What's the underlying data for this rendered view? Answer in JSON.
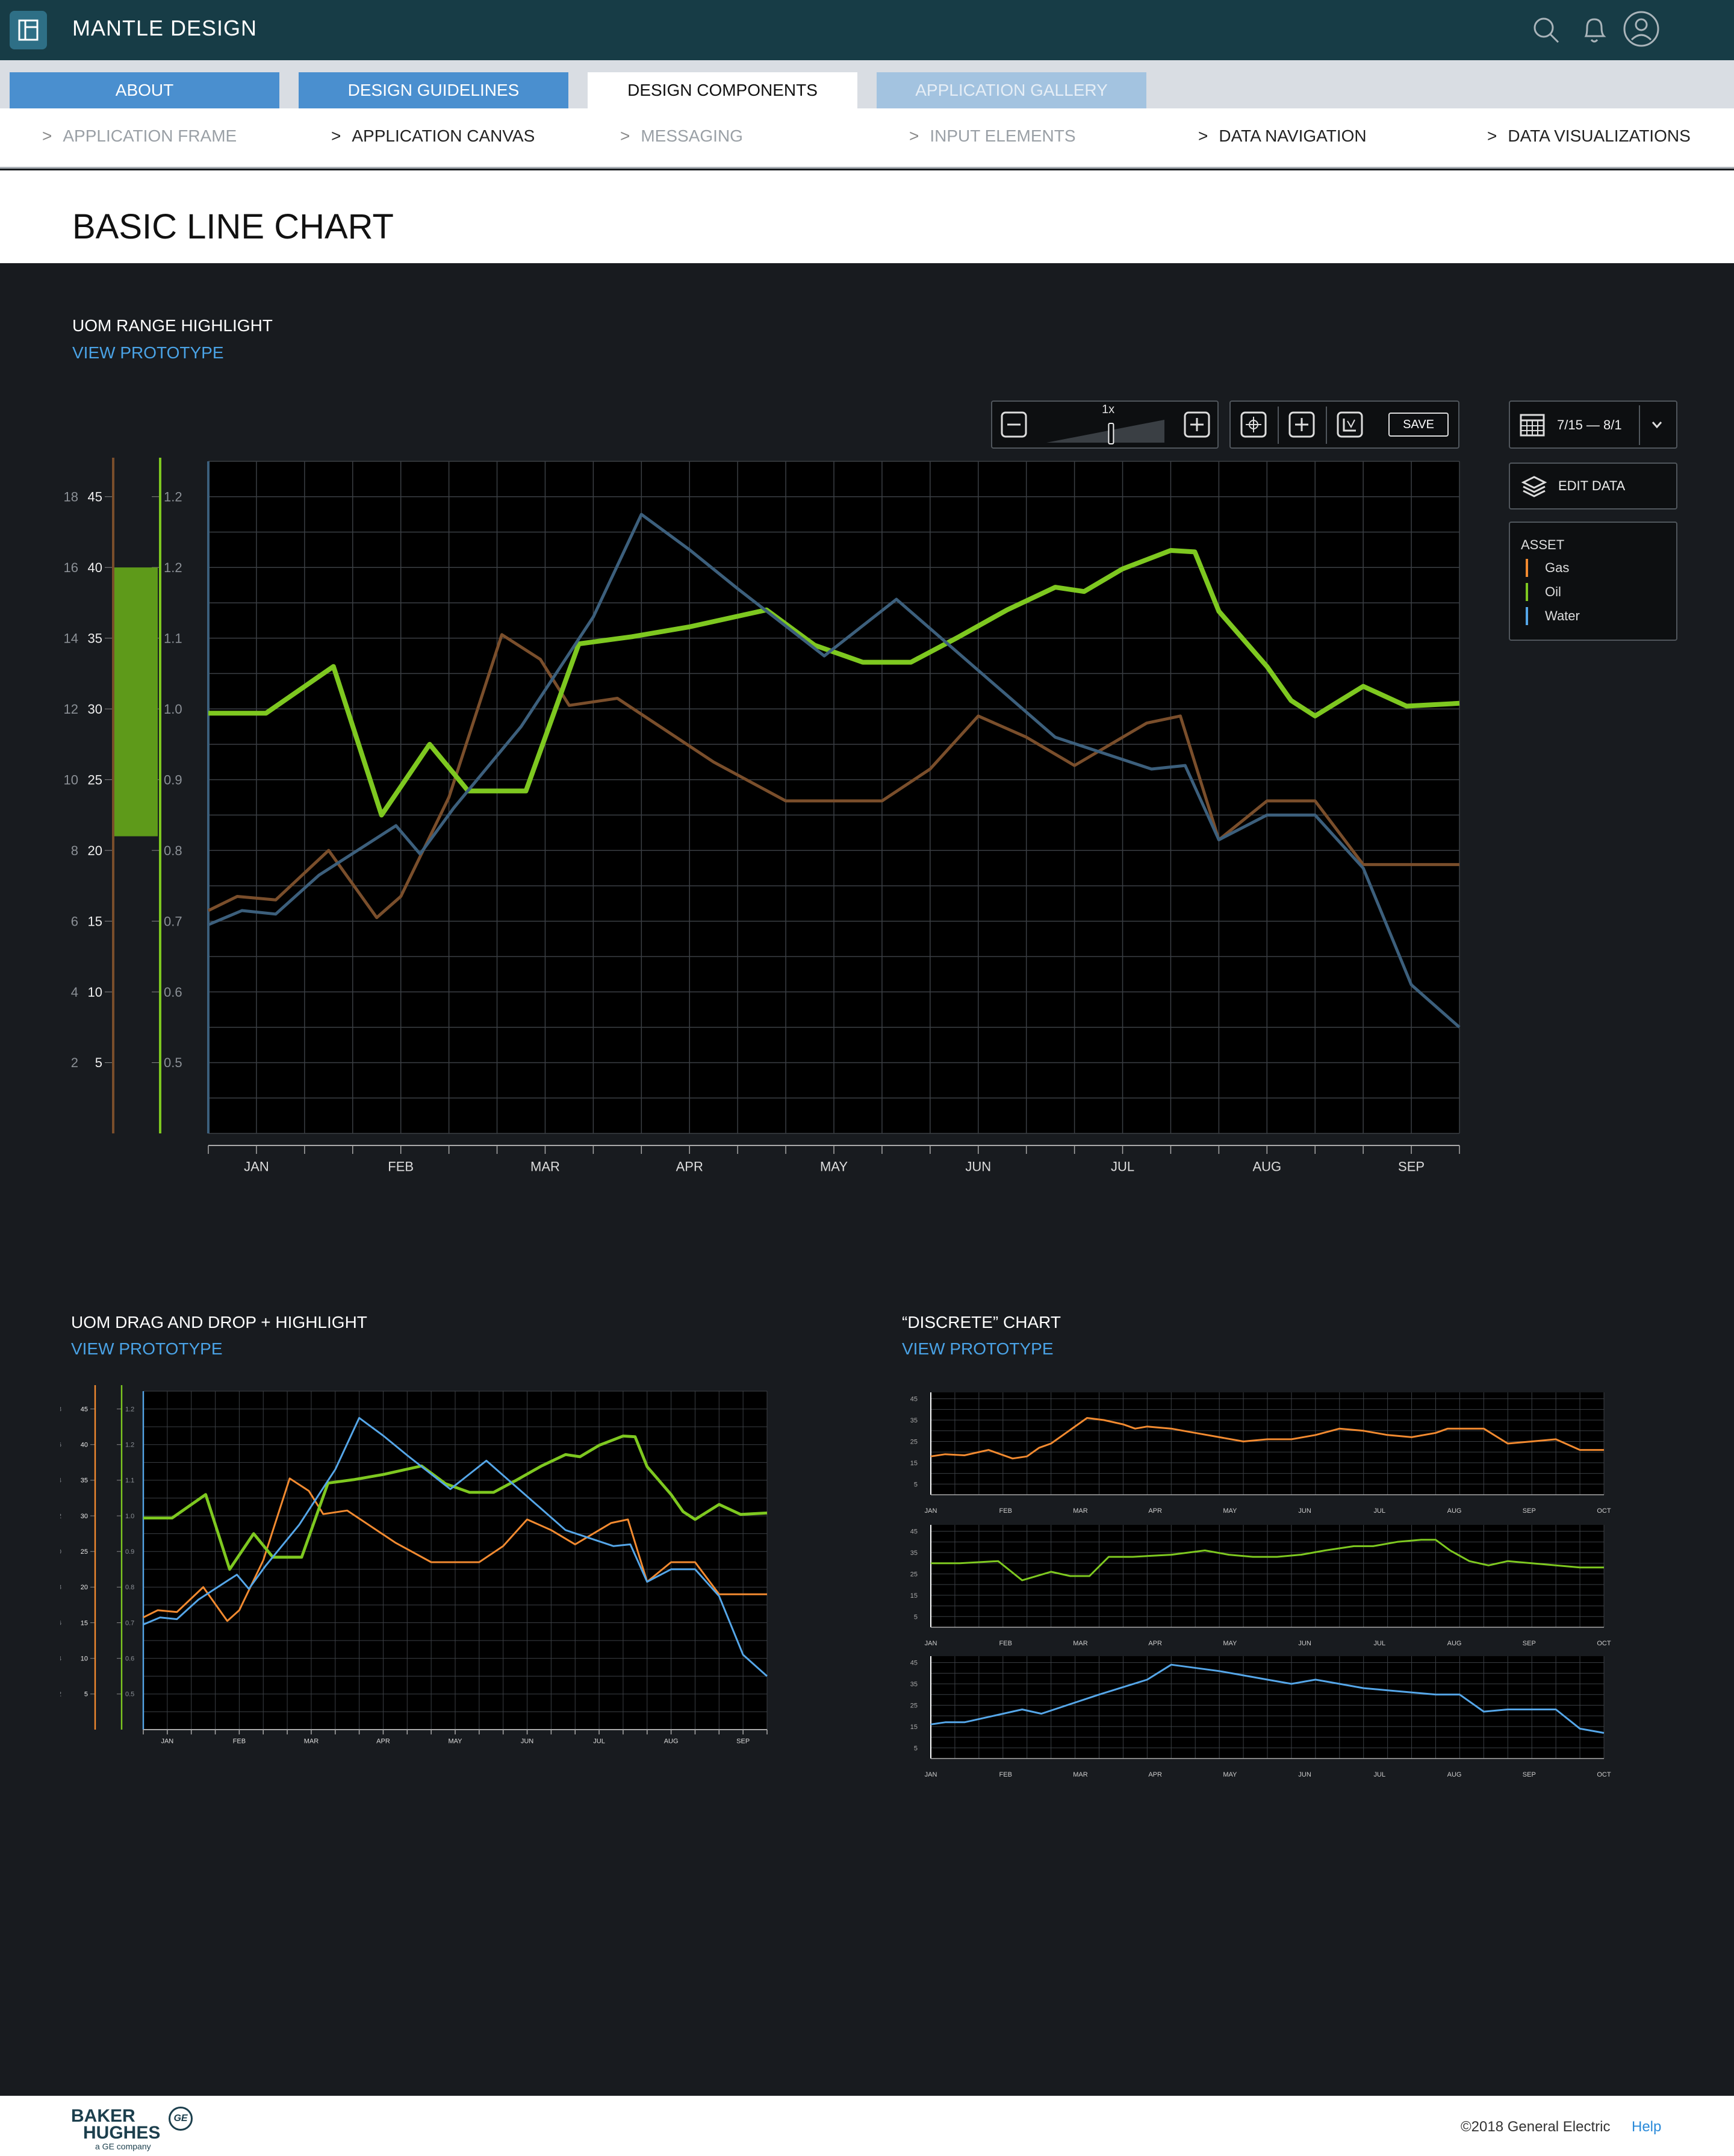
{
  "app": {
    "title": "MANTLE DESIGN"
  },
  "main_tabs": [
    {
      "label": "ABOUT",
      "state": "default"
    },
    {
      "label": "DESIGN GUIDELINES",
      "state": "default"
    },
    {
      "label": "DESIGN COMPONENTS",
      "state": "active"
    },
    {
      "label": "APPLICATION GALLERY",
      "state": "disabled"
    }
  ],
  "sub_nav": [
    {
      "label": "APPLICATION FRAME",
      "active": false
    },
    {
      "label": "APPLICATION CANVAS",
      "active": true
    },
    {
      "label": "MESSAGING",
      "active": false
    },
    {
      "label": "INPUT ELEMENTS",
      "active": false
    },
    {
      "label": "DATA NAVIGATION",
      "active": true
    },
    {
      "label": "DATA VISUALIZATIONS",
      "active": true
    }
  ],
  "page": {
    "title": "BASIC LINE CHART"
  },
  "sections": {
    "uom_range": {
      "title": "UOM RANGE HIGHLIGHT",
      "link": "VIEW PROTOTYPE"
    },
    "uom_drag": {
      "title": "UOM DRAG AND DROP + HIGHLIGHT",
      "link": "VIEW PROTOTYPE"
    },
    "discrete": {
      "title": "“DISCRETE” CHART",
      "link": "VIEW PROTOTYPE"
    }
  },
  "toolbar": {
    "zoom_label": "1x",
    "zoom_level": 0.55,
    "save_label": "SAVE"
  },
  "date_picker": {
    "range": "7/15 — 8/1"
  },
  "edit_data": {
    "label": "EDIT DATA"
  },
  "legend": {
    "title": "ASSET",
    "items": [
      {
        "label": "Gas",
        "color": "#f28a30"
      },
      {
        "label": "Oil",
        "color": "#7ec820"
      },
      {
        "label": "Water",
        "color": "#55a6e8"
      }
    ]
  },
  "colors": {
    "gas": "#f28a30",
    "oil": "#7ec820",
    "water": "#55a6e8",
    "gas_dim": "#7a4e2b",
    "water_dim": "#3c5f7c",
    "link": "#4aa3e6"
  },
  "footer": {
    "logo_line1": "BAKER",
    "logo_line2": "HUGHES",
    "logo_sub": "a GE company",
    "ge": "GE",
    "copyright": "©2018 General Electric",
    "help": "Help"
  },
  "chart_data": [
    {
      "type": "line",
      "title": "UOM RANGE HIGHLIGHT",
      "x_ticks": [
        "JAN",
        "FEB",
        "MAR",
        "APR",
        "MAY",
        "JUN",
        "JUL",
        "AUG",
        "SEP"
      ],
      "y_axes": [
        {
          "ticks": [
            "18",
            "16",
            "14",
            "12",
            "10",
            "8",
            "6",
            "4",
            "2"
          ],
          "range": [
            0,
            19
          ]
        },
        {
          "ticks": [
            "45",
            "40",
            "35",
            "30",
            "25",
            "20",
            "15",
            "10",
            "5"
          ],
          "range": [
            0,
            47.5
          ],
          "highlight": [
            21,
            40
          ]
        },
        {
          "ticks": [
            "1.2",
            "1.2",
            "1.1",
            "1.0",
            "0.9",
            "0.8",
            "0.7",
            "0.6",
            "0.5"
          ],
          "range": [
            0.4,
            1.35
          ]
        }
      ],
      "x_range": [
        0,
        26
      ],
      "series": [
        {
          "name": "Gas",
          "scale": "left",
          "color_key": "gas_dim",
          "x": [
            0,
            0.6,
            1.4,
            2.5,
            3.5,
            4,
            5,
            6.1,
            6.9,
            7.5,
            8.5,
            10.5,
            12,
            14,
            15,
            16,
            17,
            18,
            19.5,
            20.2,
            21,
            22,
            23,
            24,
            25,
            26
          ],
          "y": [
            6.3,
            6.7,
            6.6,
            8,
            6.1,
            6.7,
            9.5,
            14.1,
            13.4,
            12.1,
            12.3,
            10.5,
            9.4,
            9.4,
            10.3,
            11.8,
            11.2,
            10.4,
            11.6,
            11.8,
            8.3,
            9.4,
            9.4,
            7.6,
            7.6,
            7.6
          ]
        },
        {
          "name": "Oil",
          "scale": "middle",
          "color_key": "oil",
          "x": [
            0,
            1.2,
            2.6,
            3.6,
            4.6,
            5.4,
            6.6,
            7.7,
            8.8,
            10,
            11.6,
            12.6,
            13.6,
            14.6,
            15.6,
            16.6,
            17.6,
            18.2,
            19,
            20,
            20.5,
            21,
            22,
            22.5,
            23,
            24,
            24.9,
            26
          ],
          "y": [
            29.7,
            29.7,
            33,
            22.5,
            27.5,
            24.2,
            24.2,
            34.6,
            35.1,
            35.8,
            37,
            34.5,
            33.3,
            33.3,
            35.1,
            37,
            38.6,
            38.3,
            39.9,
            41.2,
            41.1,
            36.9,
            33,
            30.6,
            29.5,
            31.6,
            30.2,
            30.4
          ]
        },
        {
          "name": "Water",
          "scale": "left",
          "color_key": "water_dim",
          "x": [
            0,
            0.7,
            1.4,
            2.3,
            3.9,
            4.4,
            5.1,
            6.5,
            8,
            9,
            10,
            11,
            12.8,
            14.3,
            16.5,
            17.6,
            19.6,
            20.3,
            21,
            22,
            23,
            24,
            25,
            26
          ],
          "y": [
            5.9,
            6.3,
            6.2,
            7.3,
            8.7,
            7.9,
            9.2,
            11.5,
            14.6,
            17.5,
            16.5,
            15.4,
            13.5,
            15.1,
            12.5,
            11.2,
            10.3,
            10.4,
            8.3,
            9,
            9,
            7.5,
            4.2,
            3
          ]
        }
      ]
    },
    {
      "type": "line",
      "title": "UOM DRAG AND DROP + HIGHLIGHT",
      "x_ticks": [
        "JAN",
        "FEB",
        "MAR",
        "APR",
        "MAY",
        "JUN",
        "JUL",
        "AUG",
        "SEP"
      ],
      "y_axes": [
        {
          "ticks": [
            "18",
            "16",
            "14",
            "12",
            "10",
            "8",
            "6",
            "4",
            "2"
          ],
          "range": [
            0,
            19
          ]
        },
        {
          "ticks": [
            "45",
            "40",
            "35",
            "30",
            "25",
            "20",
            "15",
            "10",
            "5"
          ],
          "range": [
            0,
            47.5
          ]
        },
        {
          "ticks": [
            "1.2",
            "1.2",
            "1.1",
            "1.0",
            "0.9",
            "0.8",
            "0.7",
            "0.6",
            "0.5"
          ],
          "range": [
            0.4,
            1.35
          ]
        }
      ],
      "x_range": [
        0,
        26
      ],
      "series": [
        {
          "name": "Gas",
          "scale": "left",
          "color_key": "gas",
          "x": [
            0,
            0.6,
            1.4,
            2.5,
            3.5,
            4,
            5,
            6.1,
            6.9,
            7.5,
            8.5,
            10.5,
            12,
            14,
            15,
            16,
            17,
            18,
            19.5,
            20.2,
            21,
            22,
            23,
            24,
            25,
            26
          ],
          "y": [
            6.3,
            6.7,
            6.6,
            8,
            6.1,
            6.7,
            9.5,
            14.1,
            13.4,
            12.1,
            12.3,
            10.5,
            9.4,
            9.4,
            10.3,
            11.8,
            11.2,
            10.4,
            11.6,
            11.8,
            8.3,
            9.4,
            9.4,
            7.6,
            7.6,
            7.6
          ]
        },
        {
          "name": "Oil",
          "scale": "middle",
          "color_key": "oil",
          "x": [
            0,
            1.2,
            2.6,
            3.6,
            4.6,
            5.4,
            6.6,
            7.7,
            8.8,
            10,
            11.6,
            12.6,
            13.6,
            14.6,
            15.6,
            16.6,
            17.6,
            18.2,
            19,
            20,
            20.5,
            21,
            22,
            22.5,
            23,
            24,
            24.9,
            26
          ],
          "y": [
            29.7,
            29.7,
            33,
            22.5,
            27.5,
            24.2,
            24.2,
            34.6,
            35.1,
            35.8,
            37,
            34.5,
            33.3,
            33.3,
            35.1,
            37,
            38.6,
            38.3,
            39.9,
            41.2,
            41.1,
            36.9,
            33,
            30.6,
            29.5,
            31.6,
            30.2,
            30.4
          ]
        },
        {
          "name": "Water",
          "scale": "left",
          "color_key": "water",
          "x": [
            0,
            0.7,
            1.4,
            2.3,
            3.9,
            4.4,
            5.1,
            6.5,
            8,
            9,
            10,
            11,
            12.8,
            14.3,
            16.5,
            17.6,
            19.6,
            20.3,
            21,
            22,
            23,
            24,
            25,
            26
          ],
          "y": [
            5.9,
            6.3,
            6.2,
            7.3,
            8.7,
            7.9,
            9.2,
            11.5,
            14.6,
            17.5,
            16.5,
            15.4,
            13.5,
            15.1,
            12.5,
            11.2,
            10.3,
            10.4,
            8.3,
            9,
            9,
            7.5,
            4.2,
            3
          ]
        }
      ]
    },
    {
      "type": "line",
      "title": "“DISCRETE” CHART",
      "x_ticks": [
        "JAN",
        "FEB",
        "MAR",
        "APR",
        "MAY",
        "JUN",
        "JUL",
        "AUG",
        "SEP",
        "OCT"
      ],
      "y_ticks": [
        "45",
        "35",
        "25",
        "15",
        "5"
      ],
      "y_range": [
        0,
        48
      ],
      "x_range": [
        0,
        28
      ],
      "panels": [
        {
          "name": "Gas",
          "color_key": "gas",
          "x": [
            0,
            0.6,
            1.4,
            2.4,
            3.4,
            4,
            4.5,
            5,
            6.5,
            7.2,
            8,
            8.5,
            9,
            10,
            11,
            12,
            13,
            14,
            15,
            16,
            17,
            18,
            19,
            20,
            21,
            21.5,
            22,
            23,
            24,
            25,
            26,
            27,
            28
          ],
          "y": [
            18,
            19,
            18.5,
            21,
            17,
            18,
            22,
            24,
            36,
            35,
            33,
            31,
            32,
            31,
            29,
            27,
            25,
            26,
            26,
            28,
            31,
            30,
            28,
            27,
            29,
            31,
            31,
            31,
            24,
            25,
            26,
            21,
            21
          ]
        },
        {
          "name": "Oil",
          "color_key": "oil",
          "x": [
            0,
            1.2,
            2.8,
            3.8,
            5,
            5.8,
            6.6,
            7.4,
            8.4,
            10,
            11.4,
            12.4,
            13.4,
            14.4,
            15.4,
            16.4,
            17.6,
            18.4,
            19.4,
            20.4,
            21,
            21.6,
            22.4,
            23.2,
            24,
            25,
            26,
            27,
            28
          ],
          "y": [
            30,
            30,
            31,
            22,
            26,
            24,
            24,
            33,
            33,
            34,
            36,
            34,
            33,
            33,
            34,
            36,
            38,
            38,
            40,
            41,
            41,
            36,
            31,
            29,
            31,
            30,
            29,
            28,
            28
          ]
        },
        {
          "name": "Water",
          "color_key": "water",
          "x": [
            0,
            0.6,
            1.4,
            2.6,
            3.8,
            4.6,
            5.4,
            7,
            9,
            10,
            12,
            13,
            14,
            15,
            16,
            17,
            18,
            19,
            20,
            21,
            21.6,
            22,
            23,
            24,
            25,
            26,
            27,
            28
          ],
          "y": [
            16,
            17,
            17,
            20,
            23,
            21,
            24,
            30,
            37,
            44,
            41,
            39,
            37,
            35,
            37,
            35,
            33,
            32,
            31,
            30,
            30,
            30,
            22,
            23,
            23,
            23,
            14,
            12
          ]
        }
      ]
    }
  ]
}
